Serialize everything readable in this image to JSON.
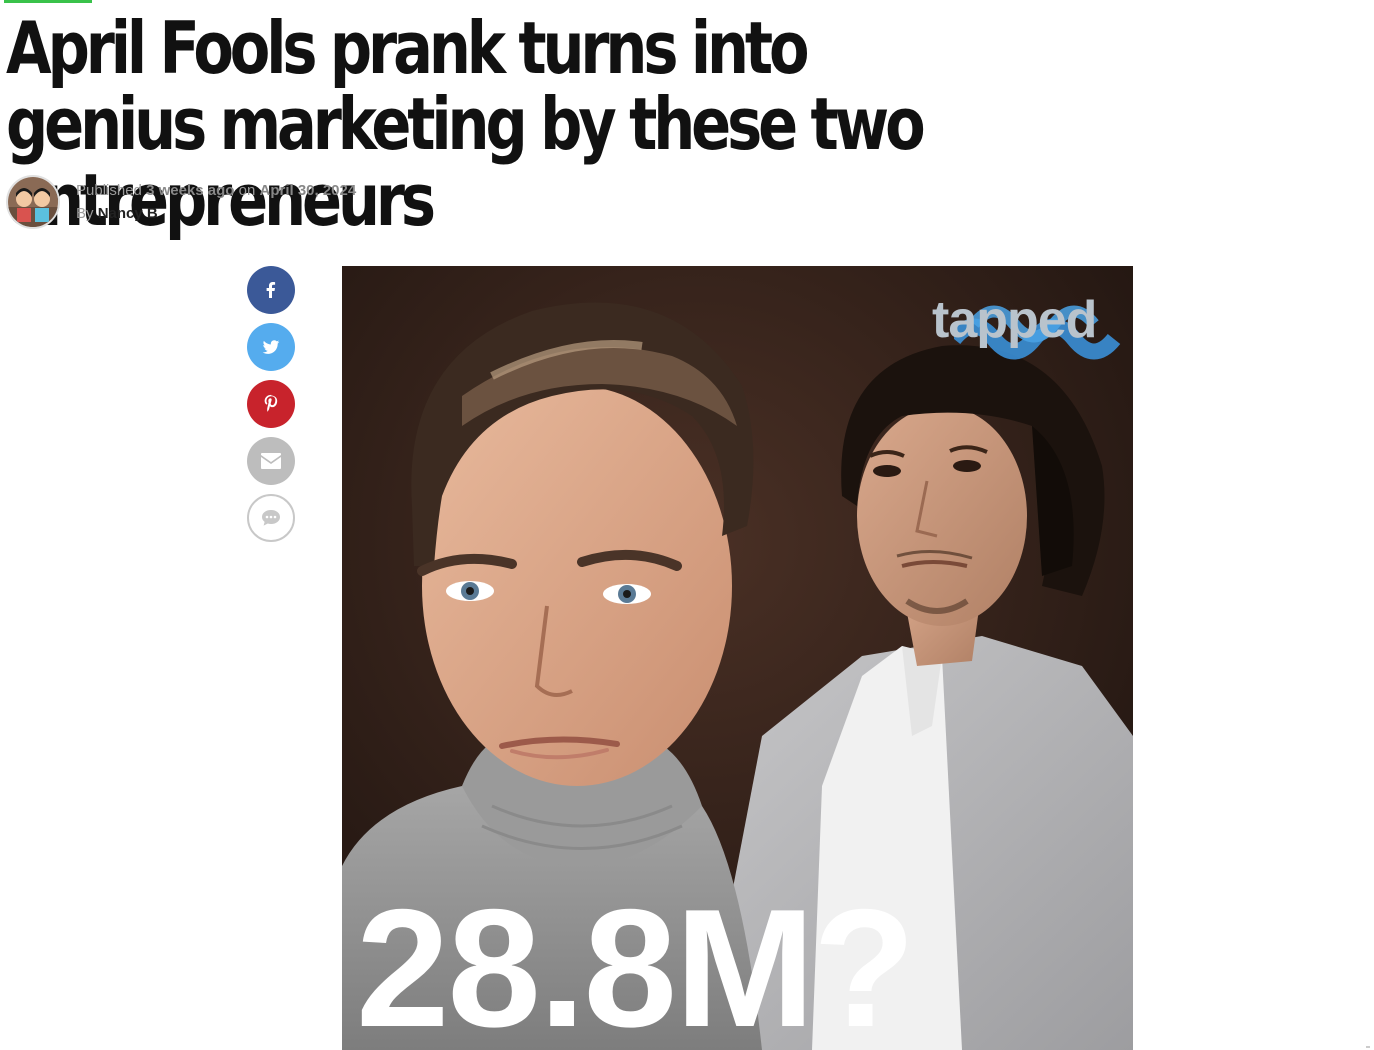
{
  "article": {
    "title": "April Fools prank turns into genius marketing by these two entrepreneurs",
    "byline": {
      "published_prefix": "Published",
      "relative_time": "3 weeks ago",
      "on_word": "on",
      "date": "April 30, 2024",
      "by_word": "By",
      "author": "Nancy B"
    }
  },
  "share": {
    "buttons": [
      {
        "icon": "facebook-icon",
        "color": "#3b5998"
      },
      {
        "icon": "twitter-icon",
        "color": "#55acee"
      },
      {
        "icon": "pinterest-icon",
        "color": "#c8232c"
      },
      {
        "icon": "email-icon",
        "color": "#bdbdbd"
      },
      {
        "icon": "comment-icon",
        "color": "#ffffff"
      }
    ]
  },
  "hero_image": {
    "overlay_number": "28.8M?",
    "brand_watermark": "tapped"
  },
  "colors": {
    "accent": "#39c24a",
    "title": "#111111",
    "meta": "#9a9a9a"
  }
}
